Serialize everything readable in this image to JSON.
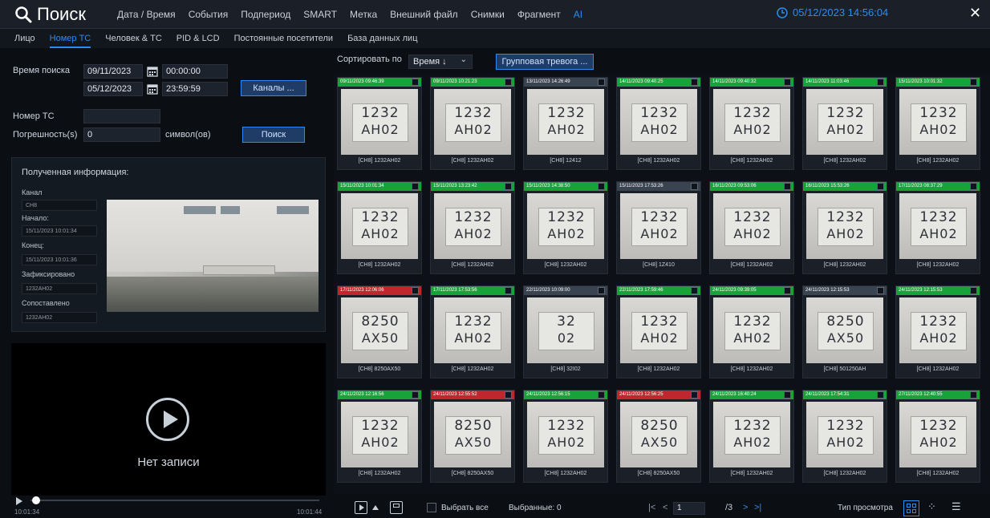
{
  "header": {
    "title": "Поиск",
    "tabs": [
      {
        "label": "Дата / Время",
        "active": false
      },
      {
        "label": "События",
        "active": false
      },
      {
        "label": "Подпериод",
        "active": false
      },
      {
        "label": "SMART",
        "active": false
      },
      {
        "label": "Метка",
        "active": false
      },
      {
        "label": "Внешний файл",
        "active": false
      },
      {
        "label": "Снимки",
        "active": false
      },
      {
        "label": "Фрагмент",
        "active": false
      },
      {
        "label": "AI",
        "active": true
      }
    ],
    "clock": "05/12/2023 14:56:04",
    "close_icon": "close-icon"
  },
  "subtabs": [
    {
      "label": "Лицо",
      "active": false
    },
    {
      "label": "Номер ТС",
      "active": true
    },
    {
      "label": "Человек & ТС",
      "active": false
    },
    {
      "label": "PID & LCD",
      "active": false
    },
    {
      "label": "Постоянные посетители",
      "active": false
    },
    {
      "label": "База данных лиц",
      "active": false
    }
  ],
  "search": {
    "time_label": "Время поиска",
    "start_date": "09/11/2023",
    "start_time": "00:00:00",
    "end_date": "05/12/2023",
    "end_time": "23:59:59",
    "channels_btn": "Каналы ...",
    "plate_label": "Номер ТС",
    "plate_value": "",
    "tolerance_label": "Погрешность(s)",
    "tolerance_value": "0",
    "tolerance_unit": "символ(ов)",
    "search_btn": "Поиск"
  },
  "info": {
    "title": "Полученная информация:",
    "channel_label": "Канал",
    "channel_value": "CH8",
    "start_label": "Начало:",
    "start_value": "15/11/2023 10:01:34",
    "end_label": "Конец:",
    "end_value": "15/11/2023 10:01:36",
    "recorded_label": "Зафиксировано",
    "recorded_value": "1232AH02",
    "matched_label": "Сопоставлено",
    "matched_value": "1232AH02"
  },
  "player": {
    "no_record": "Нет записи",
    "time_start": "10:01:34",
    "time_end": "10:01:44"
  },
  "toolbar": {
    "sort_label": "Сортировать по",
    "sort_value": "Время ↓",
    "group_alarm_btn": "Групповая тревога ..."
  },
  "results": [
    {
      "time": "09/11/2023 09:46:39",
      "status": "green",
      "caption": "[CH8] 1232AH02",
      "l1": "1232",
      "l2": "AH02"
    },
    {
      "time": "09/11/2023 10:21:23",
      "status": "green",
      "caption": "[CH8] 1232AH02",
      "l1": "1232",
      "l2": "AH02"
    },
    {
      "time": "13/11/2023 14:26:49",
      "status": "gray",
      "caption": "[CH8] 12412",
      "l1": "1232",
      "l2": "AH02"
    },
    {
      "time": "14/11/2023 09:40:25",
      "status": "green",
      "caption": "[CH8] 1232AH02",
      "l1": "1232",
      "l2": "AH02"
    },
    {
      "time": "14/11/2023 09:40:32",
      "status": "green",
      "caption": "[CH8] 1232AH02",
      "l1": "1232",
      "l2": "AH02"
    },
    {
      "time": "14/11/2023 11:03:46",
      "status": "green",
      "caption": "[CH8] 1232AH02",
      "l1": "1232",
      "l2": "AH02"
    },
    {
      "time": "15/11/2023 10:01:32",
      "status": "green",
      "caption": "[CH8] 1232AH02",
      "l1": "1232",
      "l2": "AH02"
    },
    {
      "time": "15/11/2023 10:01:34",
      "status": "green",
      "caption": "[CH8] 1232AH02",
      "l1": "1232",
      "l2": "AH02"
    },
    {
      "time": "15/11/2023 13:23:42",
      "status": "green",
      "caption": "[CH8] 1232AH02",
      "l1": "1232",
      "l2": "AH02"
    },
    {
      "time": "15/11/2023 14:38:50",
      "status": "green",
      "caption": "[CH8] 1232AH02",
      "l1": "1232",
      "l2": "AH02"
    },
    {
      "time": "15/11/2023 17:53:26",
      "status": "gray",
      "caption": "[CH8] 1Z410",
      "l1": "1232",
      "l2": "AH02"
    },
    {
      "time": "16/11/2023 09:53:06",
      "status": "green",
      "caption": "[CH8] 1232AH02",
      "l1": "1232",
      "l2": "AH02"
    },
    {
      "time": "16/11/2023 15:53:26",
      "status": "green",
      "caption": "[CH8] 1232AH02",
      "l1": "1232",
      "l2": "AH02"
    },
    {
      "time": "17/11/2023 08:37:29",
      "status": "green",
      "caption": "[CH8] 1232AH02",
      "l1": "1232",
      "l2": "AH02"
    },
    {
      "time": "17/11/2023 12:06:06",
      "status": "red",
      "caption": "[CH8] 8250AX50",
      "l1": "8250",
      "l2": "AX50"
    },
    {
      "time": "17/11/2023 17:53:56",
      "status": "green",
      "caption": "[CH8] 1232AH02",
      "l1": "1232",
      "l2": "AH02"
    },
    {
      "time": "22/11/2023 10:09:00",
      "status": "gray",
      "caption": "[CH8] 32I02",
      "l1": "32",
      "l2": "02"
    },
    {
      "time": "22/11/2023 17:59:46",
      "status": "green",
      "caption": "[CH8] 1232AH02",
      "l1": "1232",
      "l2": "AH02"
    },
    {
      "time": "24/11/2023 09:39:05",
      "status": "green",
      "caption": "[CH8] 1232AH02",
      "l1": "1232",
      "l2": "AH02"
    },
    {
      "time": "24/11/2023 12:15:53",
      "status": "gray",
      "caption": "[CH8] 501250AH",
      "l1": "8250",
      "l2": "AX50"
    },
    {
      "time": "24/11/2023 12:15:53",
      "status": "green",
      "caption": "[CH8] 1232AH02",
      "l1": "1232",
      "l2": "AH02"
    },
    {
      "time": "24/11/2023 12:16:56",
      "status": "green",
      "caption": "[CH8] 1232AH02",
      "l1": "1232",
      "l2": "AH02"
    },
    {
      "time": "24/11/2023 12:55:52",
      "status": "red",
      "caption": "[CH8] 8250AX50",
      "l1": "8250",
      "l2": "AX50"
    },
    {
      "time": "24/11/2023 12:56:15",
      "status": "green",
      "caption": "[CH8] 1232AH02",
      "l1": "1232",
      "l2": "AH02"
    },
    {
      "time": "24/11/2023 12:56:25",
      "status": "red",
      "caption": "[CH8] 8250AX50",
      "l1": "8250",
      "l2": "AX50"
    },
    {
      "time": "24/11/2023 16:40:24",
      "status": "green",
      "caption": "[CH8] 1232AH02",
      "l1": "1232",
      "l2": "AH02"
    },
    {
      "time": "24/11/2023 17:54:31",
      "status": "green",
      "caption": "[CH8] 1232AH02",
      "l1": "1232",
      "l2": "AH02"
    },
    {
      "time": "27/11/2023 12:40:55",
      "status": "green",
      "caption": "[CH8] 1232AH02",
      "l1": "1232",
      "l2": "AH02"
    }
  ],
  "bottom": {
    "select_all": "Выбрать все",
    "selected": "Выбранные: 0",
    "page_current": "1",
    "page_total": "/3",
    "view_type_label": "Тип просмотра"
  },
  "colors": {
    "accent": "#2d8cf0",
    "match_green": "#18a33a",
    "mismatch_red": "#c0262d"
  }
}
